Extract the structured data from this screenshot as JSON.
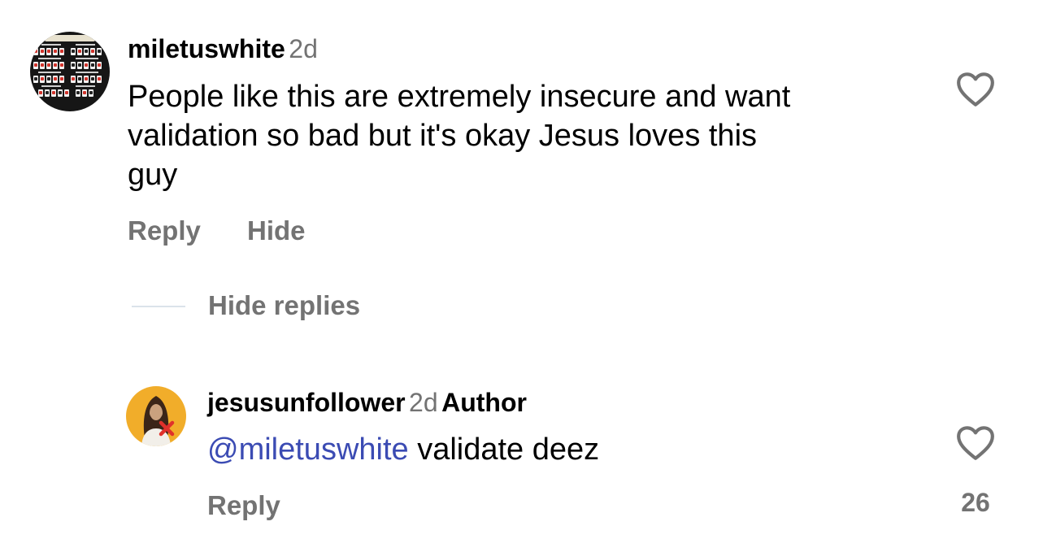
{
  "comments": [
    {
      "username": "miletuswhite",
      "time": "2d",
      "text_lines": [
        "People like this are extremely insecure and want",
        "validation so bad but it's okay Jesus loves this",
        "guy"
      ],
      "actions": {
        "reply": "Reply",
        "hide": "Hide"
      },
      "like_icon": "heart-outline-icon"
    }
  ],
  "hide_replies_label": "Hide replies",
  "reply": {
    "username": "jesusunfollower",
    "time": "2d",
    "author_badge": "Author",
    "mention": "@miletuswhite",
    "text": " validate deez",
    "actions": {
      "reply": "Reply"
    },
    "like_icon": "heart-outline-icon",
    "like_count": "26"
  },
  "colors": {
    "text_primary": "#000000",
    "text_secondary": "#737373",
    "mention": "#3b4bb3",
    "avatar_2_bg": "#f1ad2a",
    "unfollow_x": "#e0312b"
  }
}
